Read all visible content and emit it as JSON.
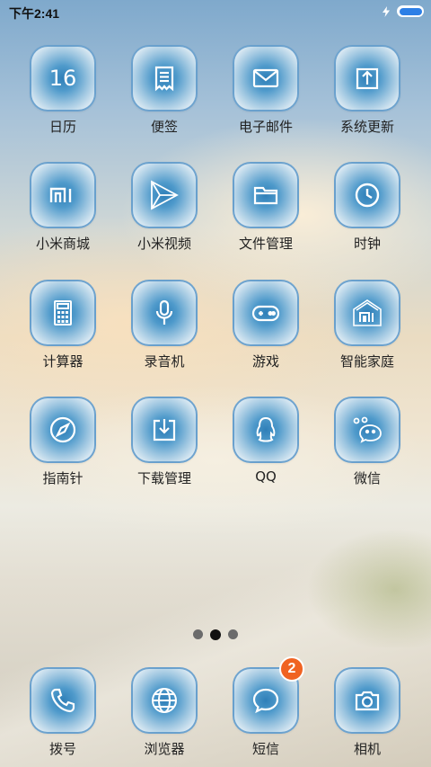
{
  "status_bar": {
    "time": "下午2:41",
    "battery_level": 1.0,
    "charging": true
  },
  "apps": [
    {
      "label": "日历",
      "icon": "calendar-icon",
      "text": "16"
    },
    {
      "label": "便签",
      "icon": "notes-icon"
    },
    {
      "label": "电子邮件",
      "icon": "mail-icon"
    },
    {
      "label": "系统更新",
      "icon": "update-icon"
    },
    {
      "label": "小米商城",
      "icon": "mi-store-icon"
    },
    {
      "label": "小米视频",
      "icon": "video-icon"
    },
    {
      "label": "文件管理",
      "icon": "folder-icon"
    },
    {
      "label": "时钟",
      "icon": "clock-icon"
    },
    {
      "label": "计算器",
      "icon": "calculator-icon"
    },
    {
      "label": "录音机",
      "icon": "microphone-icon"
    },
    {
      "label": "游戏",
      "icon": "gamepad-icon"
    },
    {
      "label": "智能家庭",
      "icon": "smart-home-icon"
    },
    {
      "label": "指南针",
      "icon": "compass-icon"
    },
    {
      "label": "下载管理",
      "icon": "download-icon"
    },
    {
      "label": "QQ",
      "icon": "qq-icon"
    },
    {
      "label": "微信",
      "icon": "wechat-icon"
    }
  ],
  "page_indicator": {
    "pages": 3,
    "current": 2
  },
  "dock": [
    {
      "label": "拨号",
      "icon": "phone-icon"
    },
    {
      "label": "浏览器",
      "icon": "browser-icon"
    },
    {
      "label": "短信",
      "icon": "message-icon",
      "badge": "2"
    },
    {
      "label": "相机",
      "icon": "camera-icon"
    }
  ],
  "colors": {
    "tile_center": "#2f7fb8",
    "tile_border": "#5a96c8",
    "badge": "#f06322",
    "battery": "#2d7fe6"
  }
}
